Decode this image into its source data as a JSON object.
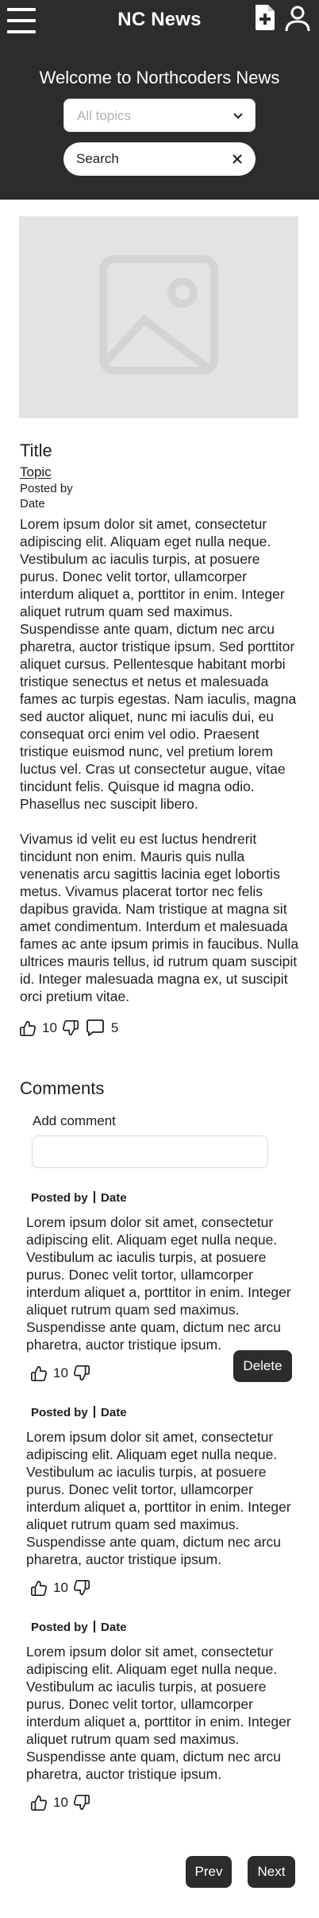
{
  "header": {
    "brand": "NC News",
    "hero_title": "Welcome to Northcoders News",
    "topic_placeholder": "All topics",
    "search_value": "Search"
  },
  "article": {
    "title": "Title",
    "topic": "Topic",
    "posted_by": "Posted by",
    "date": "Date",
    "body": [
      "Lorem ipsum dolor sit amet, consectetur adipiscing elit. Aliquam eget nulla neque. Vestibulum ac iaculis turpis, at posuere purus. Donec velit tortor, ullamcorper interdum aliquet a, porttitor in enim. Integer aliquet rutrum quam sed maximus. Suspendisse ante quam, dictum nec arcu pharetra, auctor tristique ipsum. Sed porttitor aliquet cursus. Pellentesque habitant morbi tristique senectus et netus et malesuada fames ac turpis egestas. Nam iaculis, magna sed auctor aliquet, nunc mi iaculis dui, eu consequat orci enim vel odio. Praesent tristique euismod nunc, vel pretium lorem luctus vel. Cras ut consectetur augue, vitae tincidunt felis. Quisque id magna odio. Phasellus nec suscipit libero.",
      "Vivamus id velit eu est luctus hendrerit tincidunt non enim. Mauris quis nulla venenatis arcu sagittis lacinia eget lobortis metus. Vivamus placerat tortor nec felis dapibus gravida. Nam tristique at magna sit amet condimentum. Interdum et malesuada fames ac ante ipsum primis in faucibus. Nulla ultrices mauris tellus, id rutrum quam suscipit id. Integer malesuada magna ex, ut suscipit orci pretium vitae."
    ],
    "votes": "10",
    "comment_count": "5"
  },
  "comments": {
    "heading": "Comments",
    "add_label": "Add comment",
    "items": [
      {
        "posted_by": "Posted by",
        "date": "Date",
        "body": "Lorem ipsum dolor sit amet, consectetur adipiscing elit. Aliquam eget nulla neque. Vestibulum ac iaculis turpis, at posuere purus. Donec velit tortor, ullamcorper interdum aliquet a, porttitor in enim. Integer aliquet rutrum quam sed maximus. Suspendisse ante quam, dictum nec arcu pharetra, auctor tristique ipsum.",
        "votes": "10",
        "delete_label": "Delete"
      },
      {
        "posted_by": "Posted by",
        "date": "Date",
        "body": "Lorem ipsum dolor sit amet, consectetur adipiscing elit. Aliquam eget nulla neque. Vestibulum ac iaculis turpis, at posuere purus. Donec velit tortor, ullamcorper interdum aliquet a, porttitor in enim. Integer aliquet rutrum quam sed maximus. Suspendisse ante quam, dictum nec arcu pharetra, auctor tristique ipsum.",
        "votes": "10"
      },
      {
        "posted_by": "Posted by",
        "date": "Date",
        "body": "Lorem ipsum dolor sit amet, consectetur adipiscing elit. Aliquam eget nulla neque. Vestibulum ac iaculis turpis, at posuere purus. Donec velit tortor, ullamcorper interdum aliquet a, porttitor in enim. Integer aliquet rutrum quam sed maximus. Suspendisse ante quam, dictum nec arcu pharetra, auctor tristique ipsum.",
        "votes": "10"
      }
    ]
  },
  "pagination": {
    "prev_label": "Prev",
    "next_label": "Next"
  },
  "icons": {
    "menu": "hamburger-menu-icon",
    "new_article": "add-document-icon",
    "user": "user-icon",
    "dropdown": "chevron-down-icon",
    "clear": "close-icon",
    "image_placeholder": "image-placeholder-icon",
    "upvote": "thumbs-up-icon",
    "downvote": "thumbs-down-icon",
    "comments": "comment-bubble-icon"
  },
  "colors": {
    "header_bg": "#2c2c2c",
    "text": "#1e1e1e",
    "placeholder": "#b3b3b3",
    "image_bg": "#e3e3e3"
  }
}
